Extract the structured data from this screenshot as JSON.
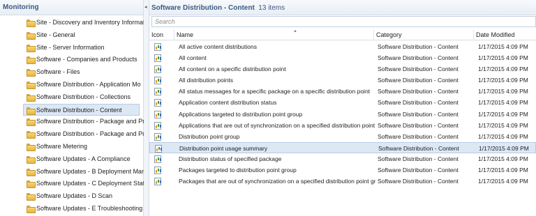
{
  "left_panel": {
    "title": "Monitoring",
    "items": [
      {
        "label": "Site - Discovery and Inventory Informat",
        "selected": false
      },
      {
        "label": "Site - General",
        "selected": false
      },
      {
        "label": "Site - Server Information",
        "selected": false
      },
      {
        "label": "Software - Companies and Products",
        "selected": false
      },
      {
        "label": "Software - Files",
        "selected": false
      },
      {
        "label": "Software Distribution - Application Mo",
        "selected": false
      },
      {
        "label": "Software Distribution - Collections",
        "selected": false
      },
      {
        "label": "Software Distribution - Content",
        "selected": true
      },
      {
        "label": "Software Distribution - Package and Pr",
        "selected": false
      },
      {
        "label": "Software Distribution - Package and Pr",
        "selected": false
      },
      {
        "label": "Software Metering",
        "selected": false
      },
      {
        "label": "Software Updates - A Compliance",
        "selected": false
      },
      {
        "label": "Software Updates - B Deployment Man",
        "selected": false
      },
      {
        "label": "Software Updates - C Deployment Stat",
        "selected": false
      },
      {
        "label": "Software Updates - D Scan",
        "selected": false
      },
      {
        "label": "Software Updates - E Troubleshooting",
        "selected": false
      }
    ]
  },
  "splitter": {
    "arrow": "◂"
  },
  "right_panel": {
    "title": "Software Distribution - Content",
    "item_count": "13 items",
    "search_placeholder": "Search",
    "columns": {
      "icon": "Icon",
      "name": "Name",
      "category": "Category",
      "date": "Date Modified"
    },
    "sort_indicator": "▲",
    "rows": [
      {
        "name": "All active content distributions",
        "category": "Software Distribution - Content",
        "date": "1/17/2015 4:09 PM",
        "selected": false
      },
      {
        "name": "All content",
        "category": "Software Distribution - Content",
        "date": "1/17/2015 4:09 PM",
        "selected": false
      },
      {
        "name": "All content on a specific distribution point",
        "category": "Software Distribution - Content",
        "date": "1/17/2015 4:09 PM",
        "selected": false
      },
      {
        "name": "All distribution points",
        "category": "Software Distribution - Content",
        "date": "1/17/2015 4:09 PM",
        "selected": false
      },
      {
        "name": "All status messages for a specific package on a specific distribution point",
        "category": "Software Distribution - Content",
        "date": "1/17/2015 4:09 PM",
        "selected": false
      },
      {
        "name": "Application content distribution status",
        "category": "Software Distribution - Content",
        "date": "1/17/2015 4:09 PM",
        "selected": false
      },
      {
        "name": "Applications targeted to distribution point group",
        "category": "Software Distribution - Content",
        "date": "1/17/2015 4:09 PM",
        "selected": false
      },
      {
        "name": "Applications that are out of synchronization on a specified distribution point g...",
        "category": "Software Distribution - Content",
        "date": "1/17/2015 4:09 PM",
        "selected": false
      },
      {
        "name": "Distribution point group",
        "category": "Software Distribution - Content",
        "date": "1/17/2015 4:09 PM",
        "selected": false
      },
      {
        "name": "Distribution point usage summary",
        "category": "Software Distribution - Content",
        "date": "1/17/2015 4:09 PM",
        "selected": true
      },
      {
        "name": "Distribution status of specified package",
        "category": "Software Distribution - Content",
        "date": "1/17/2015 4:09 PM",
        "selected": false
      },
      {
        "name": "Packages targeted to distribution point group",
        "category": "Software Distribution - Content",
        "date": "1/17/2015 4:09 PM",
        "selected": false
      },
      {
        "name": "Packages that are out of synchronization on a specified distribution point group",
        "category": "Software Distribution - Content",
        "date": "1/17/2015 4:09 PM",
        "selected": false
      }
    ]
  },
  "icons": {
    "tree_item": "folder-icon",
    "report": "report-icon",
    "collapse": "collapse-left-icon"
  },
  "colors": {
    "header_text": "#3b5a82",
    "selection_bg": "#dde8f5",
    "selection_border": "#b7cbe3",
    "folder": "#e7b640"
  }
}
